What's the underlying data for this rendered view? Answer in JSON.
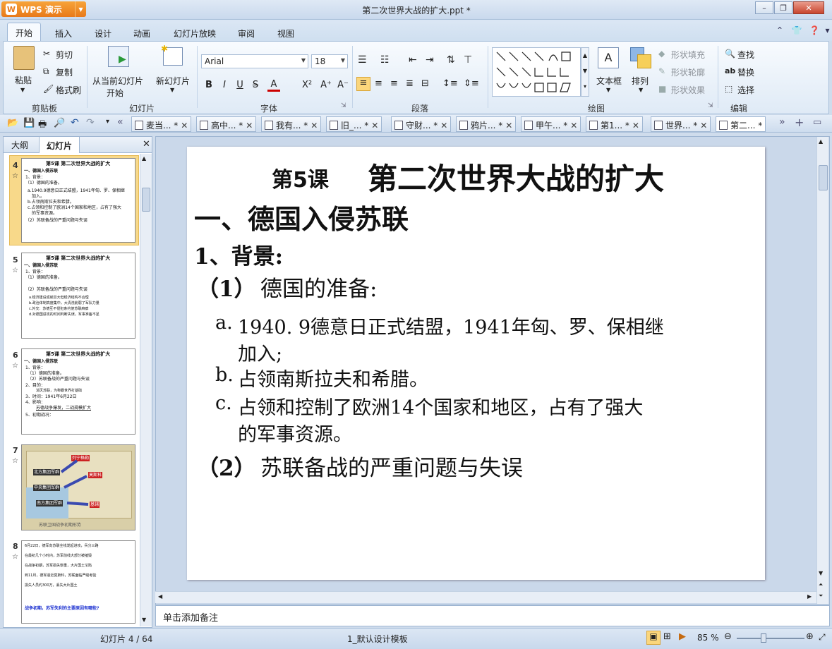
{
  "app": {
    "name": "WPS 演示",
    "doc_title": "第二次世界大战的扩大.ppt *"
  },
  "window_buttons": {
    "minimize": "–",
    "restore": "❐",
    "close": "✕"
  },
  "menu_tabs": [
    "开始",
    "插入",
    "设计",
    "动画",
    "幻灯片放映",
    "审阅",
    "视图"
  ],
  "ribbon": {
    "clipboard": {
      "paste": "粘贴",
      "cut": "剪切",
      "copy": "复制",
      "format_painter": "格式刷",
      "group": "剪贴板"
    },
    "slides": {
      "from_current": "从当前幻灯片",
      "from_current_2": "开始",
      "new_slide": "新幻灯片",
      "group": "幻灯片"
    },
    "font": {
      "name": "Arial",
      "size": "18",
      "group": "字体",
      "bold": "B",
      "italic": "I",
      "underline": "U",
      "strike": "S",
      "color": "A",
      "sup": "X²",
      "grow": "A⁺",
      "shrink": "A⁻"
    },
    "paragraph": {
      "group": "段落"
    },
    "drawing": {
      "text_box": "文本框",
      "arrange": "排列",
      "shape_fill": "形状填充",
      "shape_outline": "形状轮廓",
      "shape_effect": "形状效果",
      "group": "绘图"
    },
    "editing": {
      "find": "查找",
      "replace": "替换",
      "select": "选择",
      "group": "编辑"
    }
  },
  "doc_tabs": [
    "麦当...",
    "高中...",
    "我有...",
    "旧_...",
    "守财...",
    "鸦片...",
    "甲午...",
    "第1...",
    "世界...",
    "第二..."
  ],
  "left_panel": {
    "tab_outline": "大纲",
    "tab_slides": "幻灯片"
  },
  "thumbnails": [
    {
      "num": "4",
      "lines": [
        "第5课    第二次世界大战的扩大",
        "一、德国入侵苏联",
        "1、背景：",
        "（1）德国的准备。",
        "a.1940.9德意日正式结盟，1941年匈、罗、保相继",
        "加入。",
        "b.占领南斯拉夫和希腊。",
        "c.占领和控制了欧洲14个国家和地区，占有了强大",
        "的军事资源。",
        "（2）苏联备战的严重问题与失误"
      ]
    },
    {
      "num": "5",
      "lines": [
        "第5课    第二次世界大战的扩大",
        "一、德国入侵苏联",
        "1、背景：",
        "（1）德国的准备。",
        "（2）苏联备战的严重问题与失误",
        "a.经济建设成就巨大但经济结构不合理",
        "b.政治体制高度集中，大清洗削弱了军队力量",
        "c.外交：苏德互不侵犯条约使苏联麻痹",
        "d.对德国进攻的时间判断失误，军事准备不足"
      ]
    },
    {
      "num": "6",
      "lines": [
        "第5课    第二次世界大战的扩大",
        "一、德国入侵苏联",
        "1、背景：",
        "（1）德国的准备。",
        "（2）苏联备战的严重问题与失误",
        "2、目的：",
        "消灭苏联，为称霸世界打基础",
        "3、时间：1941年6月22日",
        "4、影响：",
        "苏德战争爆发，二战规模扩大",
        "5、初期战况："
      ]
    },
    {
      "num": "7",
      "labels": [
        "列宁格勒",
        "北方集团军群",
        "莫斯科",
        "中央集团军群",
        "南方集团军群",
        "基辅",
        "苏联卫国战争初期形势"
      ]
    },
    {
      "num": "8",
      "lines": [
        "6月22日，德军向苏联全线发起进攻，兵分三路",
        "在最初几个小时内，苏军前线大部分被摧毁",
        "在战争初期，苏军损失惨重，大片国土沦陷",
        "到11月，德军逼近莫斯科，苏联面临严峻考验",
        "损失人员约300万，丢失大片国土"
      ],
      "question": "战争初期，苏军失利的主要原因有哪些?"
    }
  ],
  "slide": {
    "title_num": "第5课",
    "title": "第二次世界大战的扩大",
    "h1": "一、德国入侵苏联",
    "h2": "1、背景:",
    "h3a_num": "（1）",
    "h3a": "德国的准备:",
    "items": [
      {
        "marker": "a.",
        "text": "1940. 9德意日正式结盟，1941年匈、罗、保相继",
        "cont": "加入;"
      },
      {
        "marker": "b.",
        "text": "占领南斯拉夫和希腊。",
        "cont": ""
      },
      {
        "marker": "c.",
        "text": "占领和控制了欧洲14个国家和地区，占有了强大",
        "cont": "的军事资源。"
      }
    ],
    "h3b_num": "（2）",
    "h3b": "苏联备战的严重问题与失误"
  },
  "notes_placeholder": "单击添加备注",
  "status": {
    "slide_count": "幻灯片 4 / 64",
    "template": "1_默认设计模板",
    "zoom": "85 %"
  },
  "colors": {
    "accent": "#e8791a",
    "ribbon_border": "#a6bed9",
    "thumb_selected": "#f8d98a"
  }
}
